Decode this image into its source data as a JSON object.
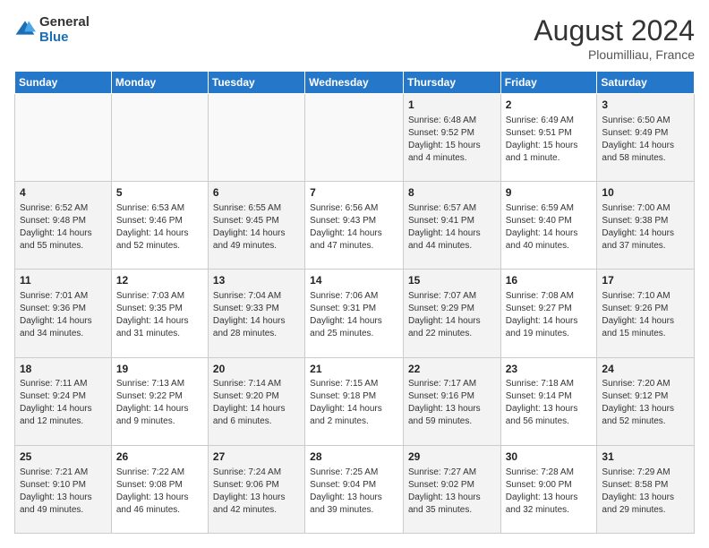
{
  "header": {
    "logo_general": "General",
    "logo_blue": "Blue",
    "month_year": "August 2024",
    "location": "Ploumilliau, France"
  },
  "days_of_week": [
    "Sunday",
    "Monday",
    "Tuesday",
    "Wednesday",
    "Thursday",
    "Friday",
    "Saturday"
  ],
  "weeks": [
    [
      {
        "day": "",
        "info": ""
      },
      {
        "day": "",
        "info": ""
      },
      {
        "day": "",
        "info": ""
      },
      {
        "day": "",
        "info": ""
      },
      {
        "day": "1",
        "info": "Sunrise: 6:48 AM\nSunset: 9:52 PM\nDaylight: 15 hours and 4 minutes."
      },
      {
        "day": "2",
        "info": "Sunrise: 6:49 AM\nSunset: 9:51 PM\nDaylight: 15 hours and 1 minute."
      },
      {
        "day": "3",
        "info": "Sunrise: 6:50 AM\nSunset: 9:49 PM\nDaylight: 14 hours and 58 minutes."
      }
    ],
    [
      {
        "day": "4",
        "info": "Sunrise: 6:52 AM\nSunset: 9:48 PM\nDaylight: 14 hours and 55 minutes."
      },
      {
        "day": "5",
        "info": "Sunrise: 6:53 AM\nSunset: 9:46 PM\nDaylight: 14 hours and 52 minutes."
      },
      {
        "day": "6",
        "info": "Sunrise: 6:55 AM\nSunset: 9:45 PM\nDaylight: 14 hours and 49 minutes."
      },
      {
        "day": "7",
        "info": "Sunrise: 6:56 AM\nSunset: 9:43 PM\nDaylight: 14 hours and 47 minutes."
      },
      {
        "day": "8",
        "info": "Sunrise: 6:57 AM\nSunset: 9:41 PM\nDaylight: 14 hours and 44 minutes."
      },
      {
        "day": "9",
        "info": "Sunrise: 6:59 AM\nSunset: 9:40 PM\nDaylight: 14 hours and 40 minutes."
      },
      {
        "day": "10",
        "info": "Sunrise: 7:00 AM\nSunset: 9:38 PM\nDaylight: 14 hours and 37 minutes."
      }
    ],
    [
      {
        "day": "11",
        "info": "Sunrise: 7:01 AM\nSunset: 9:36 PM\nDaylight: 14 hours and 34 minutes."
      },
      {
        "day": "12",
        "info": "Sunrise: 7:03 AM\nSunset: 9:35 PM\nDaylight: 14 hours and 31 minutes."
      },
      {
        "day": "13",
        "info": "Sunrise: 7:04 AM\nSunset: 9:33 PM\nDaylight: 14 hours and 28 minutes."
      },
      {
        "day": "14",
        "info": "Sunrise: 7:06 AM\nSunset: 9:31 PM\nDaylight: 14 hours and 25 minutes."
      },
      {
        "day": "15",
        "info": "Sunrise: 7:07 AM\nSunset: 9:29 PM\nDaylight: 14 hours and 22 minutes."
      },
      {
        "day": "16",
        "info": "Sunrise: 7:08 AM\nSunset: 9:27 PM\nDaylight: 14 hours and 19 minutes."
      },
      {
        "day": "17",
        "info": "Sunrise: 7:10 AM\nSunset: 9:26 PM\nDaylight: 14 hours and 15 minutes."
      }
    ],
    [
      {
        "day": "18",
        "info": "Sunrise: 7:11 AM\nSunset: 9:24 PM\nDaylight: 14 hours and 12 minutes."
      },
      {
        "day": "19",
        "info": "Sunrise: 7:13 AM\nSunset: 9:22 PM\nDaylight: 14 hours and 9 minutes."
      },
      {
        "day": "20",
        "info": "Sunrise: 7:14 AM\nSunset: 9:20 PM\nDaylight: 14 hours and 6 minutes."
      },
      {
        "day": "21",
        "info": "Sunrise: 7:15 AM\nSunset: 9:18 PM\nDaylight: 14 hours and 2 minutes."
      },
      {
        "day": "22",
        "info": "Sunrise: 7:17 AM\nSunset: 9:16 PM\nDaylight: 13 hours and 59 minutes."
      },
      {
        "day": "23",
        "info": "Sunrise: 7:18 AM\nSunset: 9:14 PM\nDaylight: 13 hours and 56 minutes."
      },
      {
        "day": "24",
        "info": "Sunrise: 7:20 AM\nSunset: 9:12 PM\nDaylight: 13 hours and 52 minutes."
      }
    ],
    [
      {
        "day": "25",
        "info": "Sunrise: 7:21 AM\nSunset: 9:10 PM\nDaylight: 13 hours and 49 minutes."
      },
      {
        "day": "26",
        "info": "Sunrise: 7:22 AM\nSunset: 9:08 PM\nDaylight: 13 hours and 46 minutes."
      },
      {
        "day": "27",
        "info": "Sunrise: 7:24 AM\nSunset: 9:06 PM\nDaylight: 13 hours and 42 minutes."
      },
      {
        "day": "28",
        "info": "Sunrise: 7:25 AM\nSunset: 9:04 PM\nDaylight: 13 hours and 39 minutes."
      },
      {
        "day": "29",
        "info": "Sunrise: 7:27 AM\nSunset: 9:02 PM\nDaylight: 13 hours and 35 minutes."
      },
      {
        "day": "30",
        "info": "Sunrise: 7:28 AM\nSunset: 9:00 PM\nDaylight: 13 hours and 32 minutes."
      },
      {
        "day": "31",
        "info": "Sunrise: 7:29 AM\nSunset: 8:58 PM\nDaylight: 13 hours and 29 minutes."
      }
    ]
  ]
}
